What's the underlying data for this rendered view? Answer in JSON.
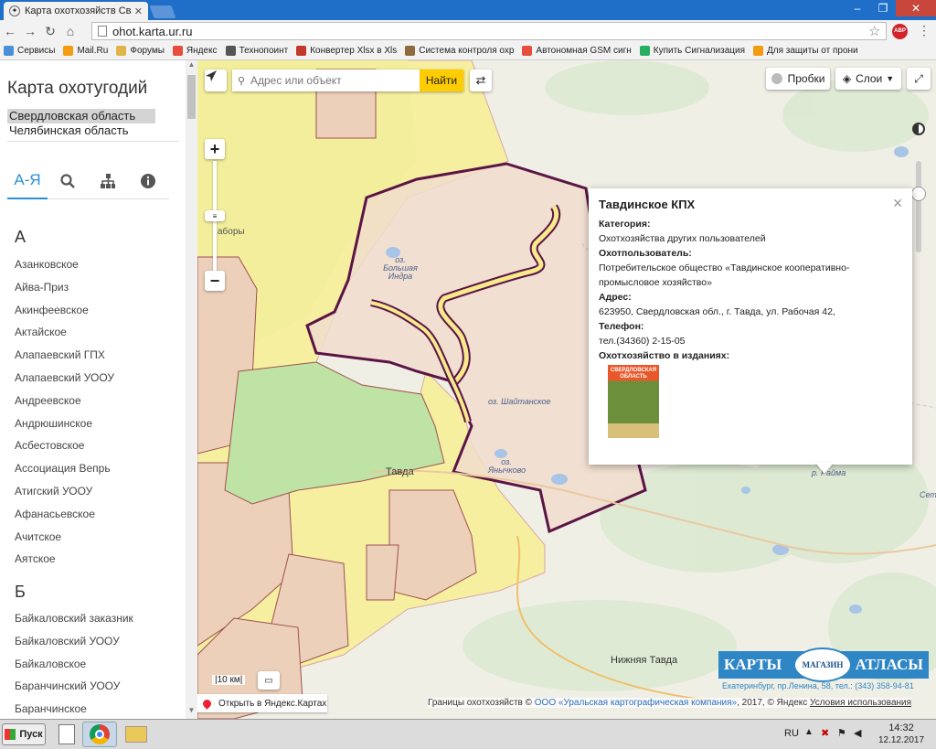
{
  "browser": {
    "tab_title": "Карта охотхозяйств Свердл",
    "url": "ohot.karta.ur.ru",
    "abp_label": "ABP",
    "bookmarks": [
      {
        "label": "Сервисы",
        "color": "#4a90d9"
      },
      {
        "label": "Mail.Ru",
        "color": "#f39c12"
      },
      {
        "label": "Форумы",
        "color": "#e0b44a"
      },
      {
        "label": "Яндекс",
        "color": "#e74c3c"
      },
      {
        "label": "Технопоинт",
        "color": "#555"
      },
      {
        "label": "Конвертер Xlsx в Xls",
        "color": "#c0392b"
      },
      {
        "label": "Система контроля охр",
        "color": "#8e6b3d"
      },
      {
        "label": "Автономная GSM сигн",
        "color": "#e74c3c"
      },
      {
        "label": "Купить Сигнализация",
        "color": "#27ae60"
      },
      {
        "label": "Для защиты от прони",
        "color": "#f39c12"
      }
    ]
  },
  "sidebar": {
    "title": "Карта охотугодий",
    "regions": [
      "Свердловская область",
      "Челябинская область"
    ],
    "tabs": [
      {
        "label": "А-Я",
        "icon": "alphabet"
      },
      {
        "label": "",
        "icon": "search-icon"
      },
      {
        "label": "",
        "icon": "hierarchy-icon"
      },
      {
        "label": "",
        "icon": "info-icon"
      }
    ],
    "letters": [
      "А",
      "Б"
    ],
    "items_a": [
      "Азанковское",
      "Айва-Приз",
      "Акинфеевское",
      "Актайское",
      "Алапаевский ГПХ",
      "Алапаевский УООУ",
      "Андреевское",
      "Андрюшинское",
      "Асбестовское",
      "Ассоциация Вепрь",
      "Атигский УООУ",
      "Афанасьевское",
      "Ачитское",
      "Аятское"
    ],
    "items_b": [
      "Байкаловский заказник",
      "Байкаловский УООУ",
      "Байкаловское",
      "Баранчинский УООУ",
      "Баранчинское"
    ]
  },
  "map": {
    "search_placeholder": "Адрес или объект",
    "search_button": "Найти",
    "traffic_label": "Пробки",
    "layers_label": "Слои",
    "labels": {
      "tavda": "Тавда",
      "nizhnyaya_tavda": "Нижняя Тавда",
      "bolshaya_indra": "оз. Большая Индра",
      "shaytanskoe": "оз. Шайтанское",
      "yanychkovo": "оз. Янычково",
      "zabory": "аборы",
      "rayma": "р. Райма",
      "sety": "Сети"
    },
    "scale": "10 км",
    "open_yandex": "Открыть в Яндекс.Картах",
    "copyright_prefix": "Границы охотхозяйств ©",
    "copyright_link": "ООО «Уральская картографическая компания»",
    "copyright_suffix": ", 2017, © Яндекс",
    "terms": "Условия использования",
    "ad": {
      "left": "КАРТЫ",
      "center": "МАГАЗИН",
      "right": "АТЛАСЫ",
      "address": "Екатеринбург, пр.Ленина, 58, тел.: (343) 358-94-81"
    }
  },
  "popup": {
    "title": "Тавдинское КПХ",
    "category_label": "Категория:",
    "category": "Охотхозяйства других пользователей",
    "user_label": "Охотпользователь:",
    "user": "Потребительское общество «Тавдинское кооперативно-промысловое хозяйство»",
    "address_label": "Адрес:",
    "address": "623950, Свердловская обл.,  г. Тавда, ул. Рабочая 42,",
    "phone_label": "Телефон:",
    "phone": "тел.(34360) 2-15-05",
    "publications_label": "Охотхозяйство в изданиях:",
    "book_title": "СВЕРДЛОВСКАЯ ОБЛАСТЬ"
  },
  "taskbar": {
    "start": "Пуск",
    "lang": "RU",
    "time": "14:32",
    "date": "12.12.2017"
  }
}
